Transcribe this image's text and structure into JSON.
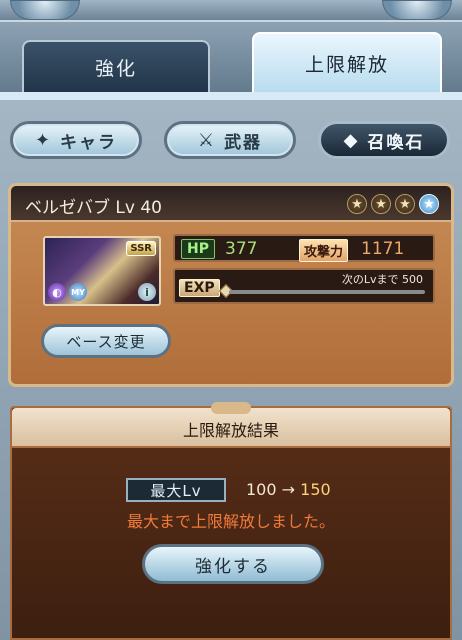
{
  "tabs": [
    {
      "label": "強化",
      "active": false
    },
    {
      "label": "上限解放",
      "active": true
    }
  ],
  "categories": [
    {
      "label": "キャラ",
      "icon": "character-icon",
      "active": false
    },
    {
      "label": "武器",
      "icon": "swords-icon",
      "active": false
    },
    {
      "label": "召喚石",
      "icon": "crystal-icon",
      "active": true
    }
  ],
  "character": {
    "name": "ベルゼバブ",
    "level_label": "Lv 40",
    "rarity": "SSR",
    "my_badge": "MY",
    "stars_total": 4,
    "stars_blue": 1,
    "hp_label": "HP",
    "hp": "377",
    "atk_label": "攻撃力",
    "atk": "1171",
    "exp_label": "EXP",
    "exp_next_label": "次のLvまで",
    "exp_next": "500",
    "exp_progress": 0.0,
    "base_change_label": "ベース変更"
  },
  "result": {
    "title": "上限解放結果",
    "max_lv_label": "最大Lv",
    "lv_from": "100",
    "arrow": "→",
    "lv_to": "150",
    "message": "最大まで上限解放しました。",
    "enhance_label": "強化する"
  },
  "colors": {
    "accent_hp": "#a6e07a",
    "accent_atk": "#f0a76a",
    "message": "#f07a3a"
  }
}
